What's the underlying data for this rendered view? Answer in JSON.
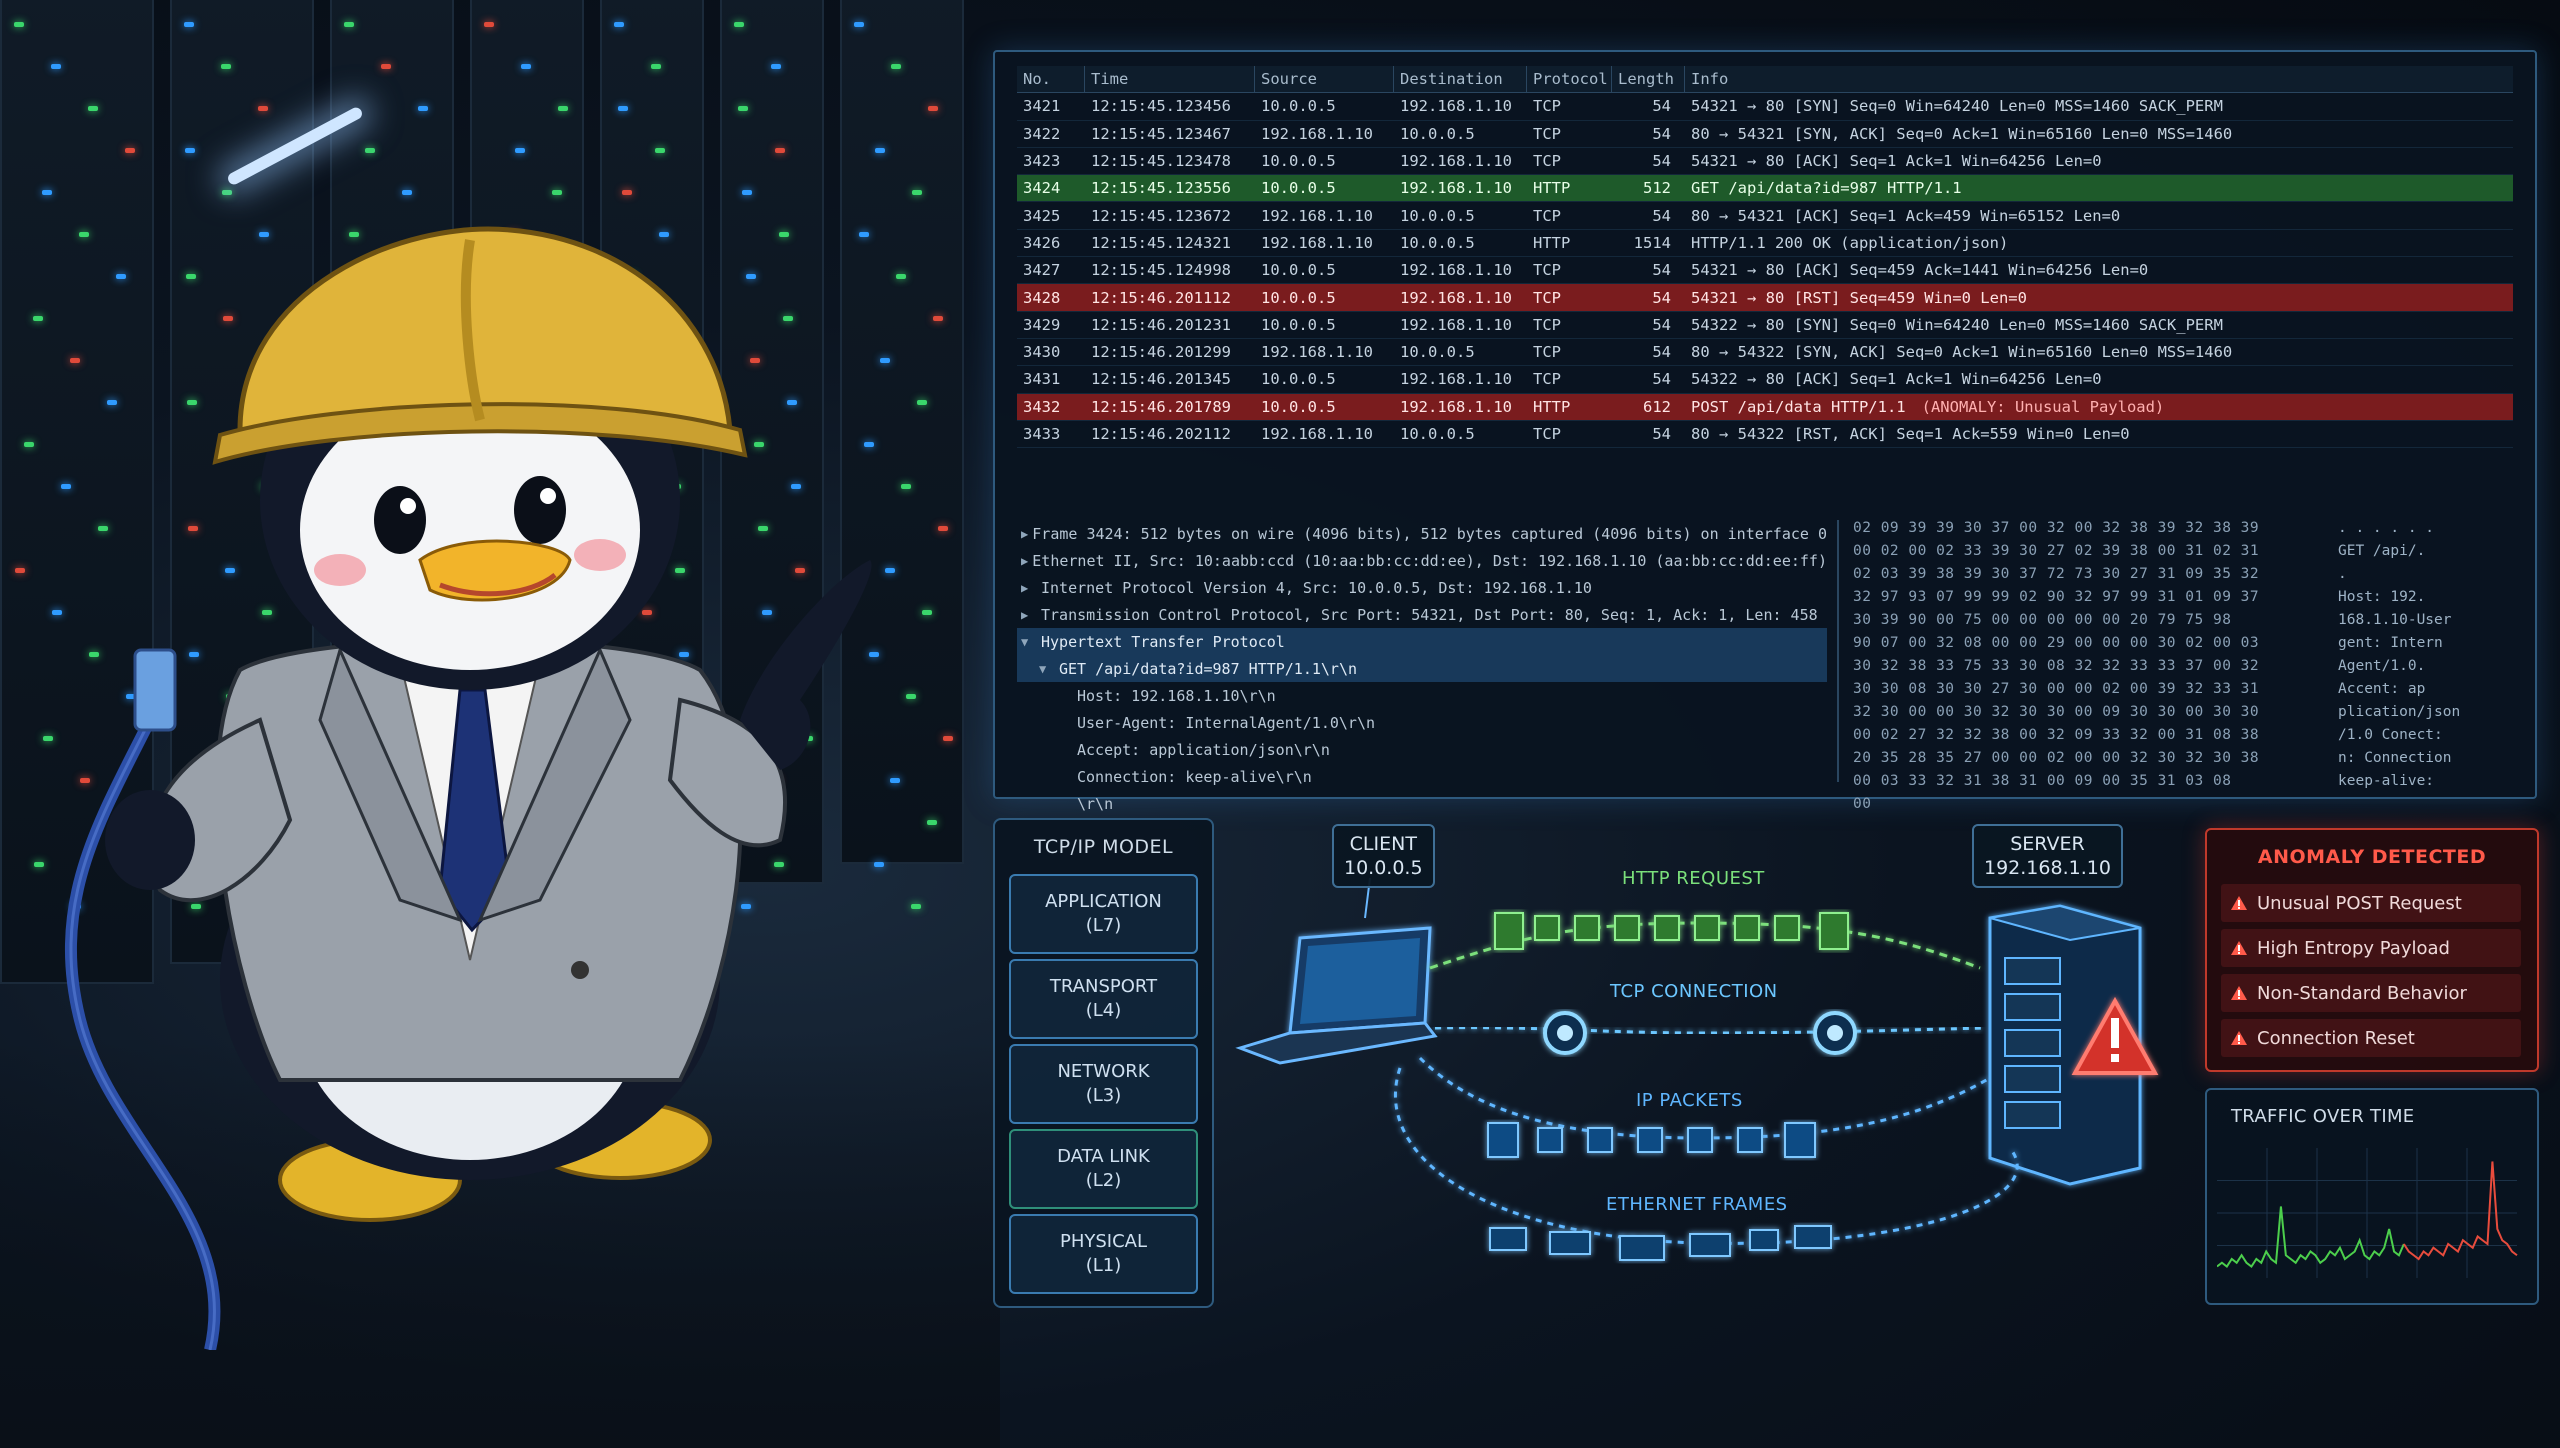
{
  "packet_list": {
    "headers": [
      "No.",
      "Time",
      "Source",
      "Destination",
      "Protocol",
      "Length",
      "Info"
    ],
    "rows": [
      {
        "no": "3421",
        "time": "12:15:45.123456",
        "src": "10.0.0.5",
        "dst": "192.168.1.10",
        "proto": "TCP",
        "len": "54",
        "info": "54321 → 80 [SYN] Seq=0 Win=64240 Len=0 MSS=1460 SACK_PERM",
        "style": ""
      },
      {
        "no": "3422",
        "time": "12:15:45.123467",
        "src": "192.168.1.10",
        "dst": "10.0.0.5",
        "proto": "TCP",
        "len": "54",
        "info": "80 → 54321 [SYN, ACK] Seq=0 Ack=1 Win=65160 Len=0 MSS=1460",
        "style": ""
      },
      {
        "no": "3423",
        "time": "12:15:45.123478",
        "src": "10.0.0.5",
        "dst": "192.168.1.10",
        "proto": "TCP",
        "len": "54",
        "info": "54321 → 80 [ACK] Seq=1 Ack=1 Win=64256 Len=0",
        "style": ""
      },
      {
        "no": "3424",
        "time": "12:15:45.123556",
        "src": "10.0.0.5",
        "dst": "192.168.1.10",
        "proto": "HTTP",
        "len": "512",
        "info": "GET /api/data?id=987 HTTP/1.1",
        "style": "hl-green"
      },
      {
        "no": "3425",
        "time": "12:15:45.123672",
        "src": "192.168.1.10",
        "dst": "10.0.0.5",
        "proto": "TCP",
        "len": "54",
        "info": "80 → 54321 [ACK] Seq=1 Ack=459 Win=65152 Len=0",
        "style": ""
      },
      {
        "no": "3426",
        "time": "12:15:45.124321",
        "src": "192.168.1.10",
        "dst": "10.0.0.5",
        "proto": "HTTP",
        "len": "1514",
        "info": "HTTP/1.1 200 OK  (application/json)",
        "style": ""
      },
      {
        "no": "3427",
        "time": "12:15:45.124998",
        "src": "10.0.0.5",
        "dst": "192.168.1.10",
        "proto": "TCP",
        "len": "54",
        "info": "54321 → 80 [ACK] Seq=459 Ack=1441 Win=64256 Len=0",
        "style": ""
      },
      {
        "no": "3428",
        "time": "12:15:46.201112",
        "src": "10.0.0.5",
        "dst": "192.168.1.10",
        "proto": "TCP",
        "len": "54",
        "info": "54321 → 80 [RST] Seq=459 Win=0 Len=0",
        "style": "hl-red"
      },
      {
        "no": "3429",
        "time": "12:15:46.201231",
        "src": "10.0.0.5",
        "dst": "192.168.1.10",
        "proto": "TCP",
        "len": "54",
        "info": "54322 → 80 [SYN] Seq=0 Win=64240 Len=0 MSS=1460 SACK_PERM",
        "style": ""
      },
      {
        "no": "3430",
        "time": "12:15:46.201299",
        "src": "192.168.1.10",
        "dst": "10.0.0.5",
        "proto": "TCP",
        "len": "54",
        "info": "80 → 54322 [SYN, ACK] Seq=0 Ack=1 Win=65160 Len=0 MSS=1460",
        "style": ""
      },
      {
        "no": "3431",
        "time": "12:15:46.201345",
        "src": "10.0.0.5",
        "dst": "192.168.1.10",
        "proto": "TCP",
        "len": "54",
        "info": "54322 → 80 [ACK] Seq=1 Ack=1 Win=64256 Len=0",
        "style": ""
      },
      {
        "no": "3432",
        "time": "12:15:46.201789",
        "src": "10.0.0.5",
        "dst": "192.168.1.10",
        "proto": "HTTP",
        "len": "612",
        "info": "POST /api/data HTTP/1.1",
        "info_extra": "(ANOMALY: Unusual Payload)",
        "style": "hl-red"
      },
      {
        "no": "3433",
        "time": "12:15:46.202112",
        "src": "192.168.1.10",
        "dst": "10.0.0.5",
        "proto": "TCP",
        "len": "54",
        "info": "80 → 54322 [RST, ACK] Seq=1 Ack=559 Win=0 Len=0",
        "style": ""
      }
    ]
  },
  "details": [
    {
      "indent": 0,
      "tri": "▶",
      "text": "Frame 3424: 512 bytes on wire (4096 bits), 512 bytes captured (4096 bits) on interface 0",
      "selected": false
    },
    {
      "indent": 0,
      "tri": "▶",
      "text": "Ethernet II, Src: 10:aabb:ccd (10:aa:bb:cc:dd:ee), Dst: 192.168.1.10 (aa:bb:cc:dd:ee:ff)",
      "selected": false
    },
    {
      "indent": 0,
      "tri": "▶",
      "text": "Internet Protocol Version 4, Src: 10.0.0.5, Dst: 192.168.1.10",
      "selected": false
    },
    {
      "indent": 0,
      "tri": "▶",
      "text": "Transmission Control Protocol, Src Port: 54321, Dst Port: 80, Seq: 1, Ack: 1, Len: 458",
      "selected": false
    },
    {
      "indent": 0,
      "tri": "▼",
      "text": "Hypertext Transfer Protocol",
      "selected": true
    },
    {
      "indent": 1,
      "tri": "▼",
      "text": "GET /api/data?id=987 HTTP/1.1\\r\\n",
      "selected": true
    },
    {
      "indent": 2,
      "tri": "",
      "text": "Host: 192.168.1.10\\r\\n",
      "selected": false
    },
    {
      "indent": 2,
      "tri": "",
      "text": "User-Agent: InternalAgent/1.0\\r\\n",
      "selected": false
    },
    {
      "indent": 2,
      "tri": "",
      "text": "Accept: application/json\\r\\n",
      "selected": false
    },
    {
      "indent": 2,
      "tri": "",
      "text": "Connection: keep-alive\\r\\n",
      "selected": false
    },
    {
      "indent": 2,
      "tri": "",
      "text": "\\r\\n",
      "selected": false
    }
  ],
  "hexdump": [
    {
      "bytes": "02 09 39 39 30 37 00 32 00 32 38 39 32 38 39",
      "ascii": ". . . . . ."
    },
    {
      "bytes": "00 02 00 02 33 39 30 27 02 39 38 00 31 02 31",
      "ascii": "GET /api/."
    },
    {
      "bytes": "02 03 39 38 39 30 37 72 73 30 27 31 09 35 32",
      "ascii": "."
    },
    {
      "bytes": "32 97 93 07 99 99 02 90 32 97 99 31 01 09 37",
      "ascii": "Host: 192."
    },
    {
      "bytes": "30 39 90 00 75 00 00 00 00 00 20 79 75 98",
      "ascii": "168.1.10-User"
    },
    {
      "bytes": "90 07 00 32 08 00 00 29 00 00 00 30 02 00 03",
      "ascii": "gent: Intern"
    },
    {
      "bytes": "30 32 38 33 75 33 30 08 32 32 33 33 37 00 32",
      "ascii": "Agent/1.0."
    },
    {
      "bytes": "30 30 08 30 30 27 30 00 00 02 00 39 32 33 31",
      "ascii": "Accent: ap"
    },
    {
      "bytes": "32 30 00 00 30 32 30 30 00 09 30 30 00 30 30",
      "ascii": "plication/json"
    },
    {
      "bytes": "00 02 27 32 32 38 00 32 09 33 32 00 31 08 38",
      "ascii": "/1.0 Conect:"
    },
    {
      "bytes": "20 35 28 35 27 00 00 02 00 00 32 30 32 30 38",
      "ascii": "n: Connection"
    },
    {
      "bytes": "00 03 33 32 31 38 31 00 09 00 35 31 03 08",
      "ascii": "keep-alive:"
    },
    {
      "bytes": "00",
      "ascii": ""
    }
  ],
  "model": {
    "title": "TCP/IP MODEL",
    "layers": [
      {
        "name": "APPLICATION",
        "code": "(L7)",
        "color": "#3a7bb0"
      },
      {
        "name": "TRANSPORT",
        "code": "(L4)",
        "color": "#3a7bb0"
      },
      {
        "name": "NETWORK",
        "code": "(L3)",
        "color": "#3a7bb0"
      },
      {
        "name": "DATA LINK",
        "code": "(L2)",
        "color": "#2f8f7a"
      },
      {
        "name": "PHYSICAL",
        "code": "(L1)",
        "color": "#3a7bb0"
      }
    ]
  },
  "diagram": {
    "client_label": "CLIENT",
    "client_ip": "10.0.0.5",
    "server_label": "SERVER",
    "server_ip": "192.168.1.10",
    "flows": [
      {
        "label": "HTTP REQUEST",
        "color": "#7be07b"
      },
      {
        "label": "TCP CONNECTION",
        "color": "#6cc7ff"
      },
      {
        "label": "IP PACKETS",
        "color": "#5fb6ff"
      },
      {
        "label": "ETHERNET FRAMES",
        "color": "#5fb6ff"
      }
    ]
  },
  "anomaly": {
    "title": "ANOMALY DETECTED",
    "items": [
      "Unusual POST Request",
      "High Entropy Payload",
      "Non-Standard Behavior",
      "Connection Reset"
    ],
    "color": "#ff5a4a"
  },
  "traffic": {
    "title": "TRAFFIC OVER TIME"
  },
  "chart_data": {
    "type": "line",
    "series": [
      {
        "values": [
          2,
          3,
          2,
          4,
          3,
          5,
          3,
          2,
          4,
          3,
          6,
          4,
          3,
          18,
          5,
          4,
          3,
          5,
          4,
          6,
          5,
          3,
          4,
          6,
          5,
          7,
          4,
          5,
          6,
          9,
          5,
          4,
          6,
          5,
          7,
          12,
          6,
          5,
          8,
          6,
          5,
          4,
          6,
          5,
          7,
          6,
          5,
          8,
          7,
          6,
          9,
          8,
          7,
          10,
          9,
          8,
          30,
          12,
          9,
          8,
          6,
          5
        ]
      }
    ],
    "colors": {
      "green": "#4ccf4c",
      "red": "#e84c3d"
    }
  }
}
